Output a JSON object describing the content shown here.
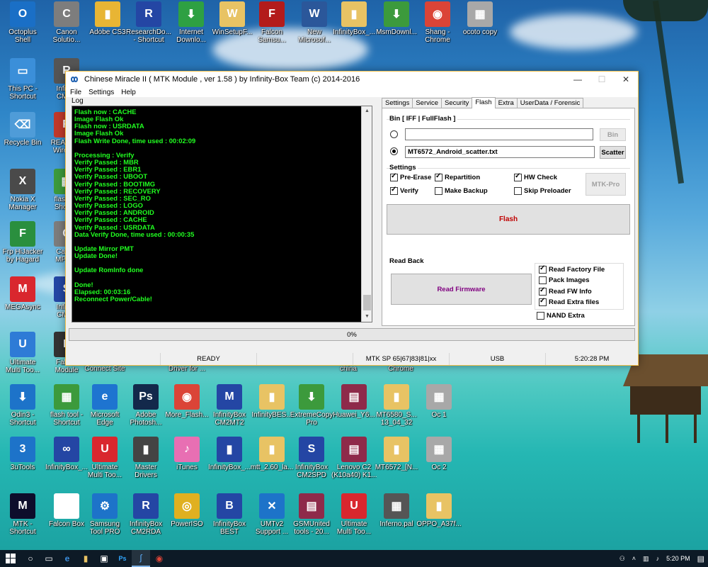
{
  "desktop": {
    "icons": [
      {
        "label": "Octoplus\nShell",
        "color": "#1a6fc6",
        "glyph": "O"
      },
      {
        "label": "Canon\nSolutio...",
        "color": "#7d7d7d",
        "glyph": "C"
      },
      {
        "label": "Adobe CS3",
        "color": "#e8b534",
        "glyph": "▮"
      },
      {
        "label": "ResearchDo...\n- Shortcut",
        "color": "#2446a4",
        "glyph": "R"
      },
      {
        "label": "Internet\nDownlo...",
        "color": "#2ea043",
        "glyph": "⬇"
      },
      {
        "label": "WinSetupF...",
        "color": "#e8c364",
        "glyph": "W"
      },
      {
        "label": "Falcon\nSamsu...",
        "color": "#b31b1b",
        "glyph": "F"
      },
      {
        "label": "New\nMicrosof...",
        "color": "#2b579a",
        "glyph": "W"
      },
      {
        "label": "InfinityBox_...",
        "color": "#e8c364",
        "glyph": "▮"
      },
      {
        "label": "MsmDownl...",
        "color": "#3c9a3c",
        "glyph": "⬇"
      },
      {
        "label": "Shang -\nChrome",
        "color": "#db4437",
        "glyph": "◉"
      },
      {
        "label": "ocoto copy",
        "color": "#a8a8a8",
        "glyph": "▦"
      },
      {
        "label": "This PC -\nShortcut",
        "color": "#3b8fd9",
        "glyph": "▭"
      },
      {
        "label": "Infinity\nCM2R",
        "color": "#555",
        "glyph": "R"
      },
      {
        "label": "Recycle Bin",
        "color": "#4f9cd8",
        "glyph": "⌫"
      },
      {
        "label": "REALTEK\nWireless",
        "color": "#c0392b",
        "glyph": "R"
      },
      {
        "label": "Nokia X\nManager",
        "color": "#4a4a4a",
        "glyph": "X"
      },
      {
        "label": "flash_to\nShortcu",
        "color": "#3c9a3c",
        "glyph": "▦"
      },
      {
        "label": "Frp HiJacker\nby Hagard",
        "color": "#2a8f3e",
        "glyph": "F"
      },
      {
        "label": "Canon\nMP280",
        "color": "#7d7d7d",
        "glyph": "C"
      },
      {
        "label": "MEGAsync",
        "color": "#d9272e",
        "glyph": "M"
      },
      {
        "label": "Infinity\nCM2S",
        "color": "#2446a4",
        "glyph": "S"
      },
      {
        "label": "Ultimate\nMulti Too...",
        "color": "#2e7bd6",
        "glyph": "U"
      },
      {
        "label": "Falcon\nModule",
        "color": "#333",
        "glyph": "F"
      },
      {
        "label": "Connect Site",
        "color": "#000000",
        "glyph": ""
      },
      {
        "label": "Driver for ...",
        "color": "#000000",
        "glyph": ""
      },
      {
        "label": "china",
        "color": "#000000",
        "glyph": ""
      },
      {
        "label": "Chrome",
        "color": "#000000",
        "glyph": ""
      },
      {
        "label": "Odin3 -\nShortcut",
        "color": "#1d73c9",
        "glyph": "⬇"
      },
      {
        "label": "flash tool -\nShortcut",
        "color": "#3c9a3c",
        "glyph": "▦"
      },
      {
        "label": "Microsoft\nEdge",
        "color": "#1e74d0",
        "glyph": "e"
      },
      {
        "label": "Adobe\nPhotosh...",
        "color": "#13294b",
        "glyph": "Ps"
      },
      {
        "label": "More_Flash...",
        "color": "#db4437",
        "glyph": "◉"
      },
      {
        "label": "InfinityBox\nCM2MT2",
        "color": "#2446a4",
        "glyph": "M"
      },
      {
        "label": "InfinityBES...",
        "color": "#e8c364",
        "glyph": "▮"
      },
      {
        "label": "ExtremeCopy\nPro",
        "color": "#3c9a3c",
        "glyph": "⬇"
      },
      {
        "label": "Huawei_Y6...",
        "color": "#8e2a4a",
        "glyph": "▤"
      },
      {
        "label": "MT6580_S...\n13_04_32",
        "color": "#e8c364",
        "glyph": "▮"
      },
      {
        "label": "Oc 1",
        "color": "#a8a8a8",
        "glyph": "▦"
      },
      {
        "label": "3uTools",
        "color": "#1d73c9",
        "glyph": "3"
      },
      {
        "label": "InfinityBox_...",
        "color": "#2446a4",
        "glyph": "∞"
      },
      {
        "label": "Ultimate\nMulti Too...",
        "color": "#d9272e",
        "glyph": "U"
      },
      {
        "label": "Master\nDrivers",
        "color": "#444",
        "glyph": "▮"
      },
      {
        "label": "iTunes",
        "color": "#e86fb3",
        "glyph": "♪"
      },
      {
        "label": "InfinityBox_...",
        "color": "#2446a4",
        "glyph": "▮"
      },
      {
        "label": "mtt_2.60_la...",
        "color": "#e8c364",
        "glyph": "▮"
      },
      {
        "label": "InfinityBox\nCM2SPD",
        "color": "#2446a4",
        "glyph": "S"
      },
      {
        "label": "Lenovo C2\n(K10a40) K1...",
        "color": "#8e2a4a",
        "glyph": "▤"
      },
      {
        "label": "MT6572_[N...",
        "color": "#e8c364",
        "glyph": "▮"
      },
      {
        "label": "Oc 2",
        "color": "#a8a8a8",
        "glyph": "▦"
      },
      {
        "label": "MTK -\nShortcut",
        "color": "#0d0d2b",
        "glyph": "M"
      },
      {
        "label": "Falcon Box",
        "color": "#fff",
        "glyph": "F"
      },
      {
        "label": "Samsung\nTool PRO",
        "color": "#1d73c9",
        "glyph": "⚙"
      },
      {
        "label": "InfinityBox\nCM2RDA",
        "color": "#2446a4",
        "glyph": "R"
      },
      {
        "label": "PowerISO",
        "color": "#e0b020",
        "glyph": "◎"
      },
      {
        "label": "InfinityBox\nBEST",
        "color": "#2446a4",
        "glyph": "B"
      },
      {
        "label": "UMTv2\nSupport ...",
        "color": "#1d73c9",
        "glyph": "✕"
      },
      {
        "label": "GSMUnited\ntools - 20...",
        "color": "#8e2a4a",
        "glyph": "▤"
      },
      {
        "label": "Ultimate\nMulti Too...",
        "color": "#d9272e",
        "glyph": "U"
      },
      {
        "label": "Inferno.pal",
        "color": "#555",
        "glyph": "▦"
      },
      {
        "label": "OPPO_A37f...",
        "color": "#e8c364",
        "glyph": "▮"
      }
    ]
  },
  "window": {
    "title": "Chinese Miracle II ( MTK Module , ver 1.58 ) by Infinity-Box Team (c) 2014-2016",
    "minimize": "—",
    "maximize": "☐",
    "close": "✕",
    "menu": [
      "File",
      "Settings",
      "Help"
    ],
    "log_label": "Log",
    "log_lines": [
      "Flash now : CACHE",
      "Image Flash Ok",
      "Flash now : USRDATA",
      "Image Flash Ok",
      "Flash Write Done, time used : 00:02:09",
      "",
      "Processing : Verify",
      "Verify Passed : MBR",
      "Verify Passed : EBR1",
      "Verify Passed : UBOOT",
      "Verify Passed : BOOTIMG",
      "Verify Passed : RECOVERY",
      "Verify Passed : SEC_RO",
      "Verify Passed : LOGO",
      "Verify Passed : ANDROID",
      "Verify Passed : CACHE",
      "Verify Passed : USRDATA",
      "Data Verify Done, time used : 00:00:35",
      "",
      "Update Mirror PMT",
      "Update Done!",
      "",
      "Update RomInfo done",
      "",
      "Done!",
      "Elapsed: 00:03:16",
      "Reconnect Power/Cable!"
    ],
    "tabs": [
      "Settings",
      "Service",
      "Security",
      "Flash",
      "Extra",
      "UserData / Forensic"
    ],
    "active_tab": "Flash",
    "bin_group_title": "Bin  [ IFF | FullFlash ]",
    "bin_value": "",
    "bin_button": "Bin",
    "scatter_value": "MT6572_Android_scatter.txt",
    "scatter_button": "Scatter",
    "settings_title": "Settings",
    "checks": [
      {
        "label": "Pre-Erase",
        "checked": true
      },
      {
        "label": "Repartition",
        "checked": true
      },
      {
        "label": "HW Check",
        "checked": true
      },
      {
        "label": "Verify",
        "checked": true
      },
      {
        "label": "Make Backup",
        "checked": false
      },
      {
        "label": "Skip Preloader",
        "checked": false
      }
    ],
    "mtkpro_button": "MTK-Pro",
    "flash_button": "Flash",
    "flash_button_color": "#c00000",
    "readback_title": "Read Back",
    "read_firmware_button": "Read Firmware",
    "read_firmware_color": "#800080",
    "read_checks": [
      {
        "label": "Read Factory File",
        "checked": true
      },
      {
        "label": "Pack Images",
        "checked": false
      },
      {
        "label": "Read FW Info",
        "checked": true
      },
      {
        "label": "Read Extra files",
        "checked": true
      }
    ],
    "nand_extra": {
      "label": "NAND Extra",
      "checked": false
    },
    "progress_text": "0%",
    "progress_value": 0,
    "status": {
      "ready": "READY",
      "platform": "MTK SP 65|67|83|81|xx",
      "port": "USB",
      "time": "5:20:28 PM"
    }
  },
  "taskbar": {
    "time": "5:20 PM",
    "icons": [
      "start-icon",
      "search-icon",
      "task-view-icon",
      "edge-icon",
      "explorer-icon",
      "store-icon",
      "photoshop-icon",
      "miracle-icon",
      "chrome-icon"
    ]
  }
}
